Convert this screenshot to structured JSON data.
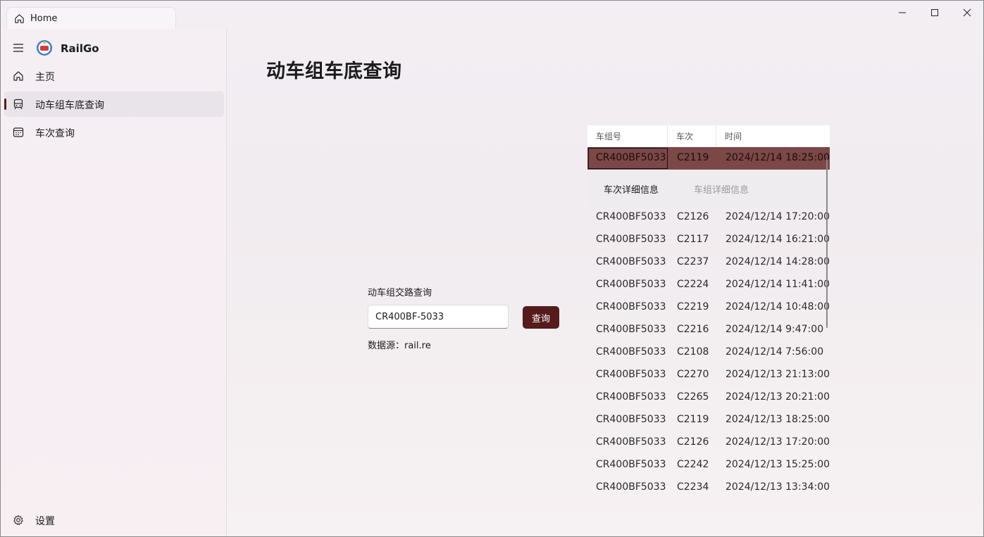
{
  "window": {
    "tab_title": "Home",
    "controls": {
      "minimize": "minimize-icon",
      "maximize": "maximize-icon",
      "close": "close-icon"
    }
  },
  "sidebar": {
    "app_name": "RailGo",
    "items": [
      {
        "label": "主页",
        "icon": "home-icon",
        "active": false
      },
      {
        "label": "动车组车底查询",
        "icon": "train-icon",
        "active": true
      },
      {
        "label": "车次查询",
        "icon": "calendar-icon",
        "active": false
      }
    ],
    "settings_label": "设置"
  },
  "main": {
    "title": "动车组车底查询",
    "query": {
      "label": "动车组交路查询",
      "value": "CR400BF-5033",
      "button": "查询",
      "data_source": "数据源：rail.re"
    },
    "table": {
      "headers": [
        "车组号",
        "车次",
        "时间"
      ],
      "selected_row": {
        "unit": "CR400BF5033",
        "train": "C2119",
        "time": "2024/12/14 18:25:00",
        "detail_tabs": [
          "车次详细信息",
          "车组详细信息"
        ]
      },
      "rows": [
        [
          "CR400BF5033",
          "C2126",
          "2024/12/14 17:20:00"
        ],
        [
          "CR400BF5033",
          "C2117",
          "2024/12/14 16:21:00"
        ],
        [
          "CR400BF5033",
          "C2237",
          "2024/12/14 14:28:00"
        ],
        [
          "CR400BF5033",
          "C2224",
          "2024/12/14 11:41:00"
        ],
        [
          "CR400BF5033",
          "C2219",
          "2024/12/14 10:48:00"
        ],
        [
          "CR400BF5033",
          "C2216",
          "2024/12/14 9:47:00"
        ],
        [
          "CR400BF5033",
          "C2108",
          "2024/12/14 7:56:00"
        ],
        [
          "CR400BF5033",
          "C2270",
          "2024/12/13 21:13:00"
        ],
        [
          "CR400BF5033",
          "C2265",
          "2024/12/13 20:21:00"
        ],
        [
          "CR400BF5033",
          "C2119",
          "2024/12/13 18:25:00"
        ],
        [
          "CR400BF5033",
          "C2126",
          "2024/12/13 17:20:00"
        ],
        [
          "CR400BF5033",
          "C2242",
          "2024/12/13 15:25:00"
        ],
        [
          "CR400BF5033",
          "C2234",
          "2024/12/13 13:34:00"
        ]
      ]
    }
  },
  "colors": {
    "accent": "#561b1b",
    "selected_row": "#7b4747"
  }
}
